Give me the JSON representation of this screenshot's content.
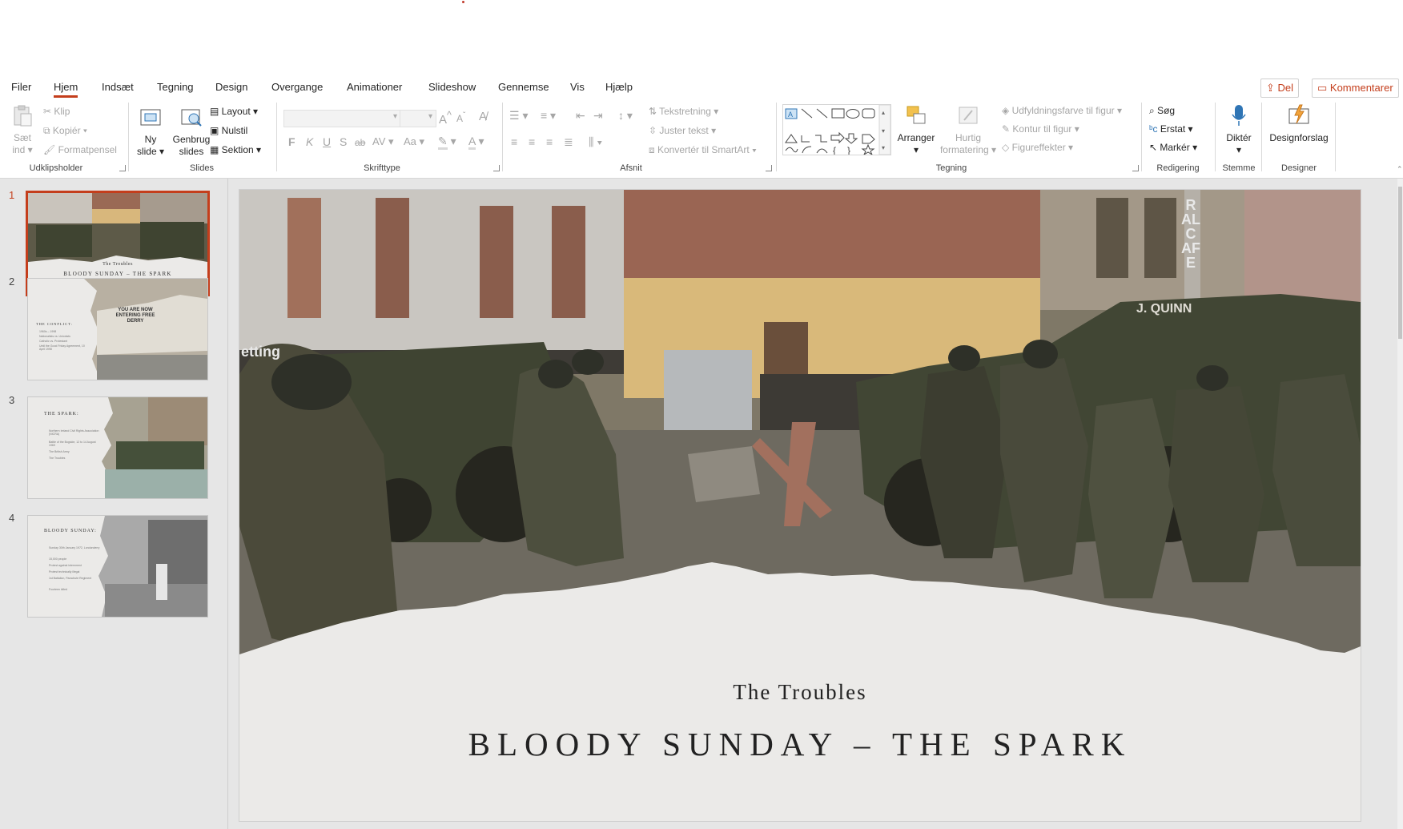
{
  "tabs": [
    "Filer",
    "Hjem",
    "Indsæt",
    "Tegning",
    "Design",
    "Overgange",
    "Animationer",
    "Slideshow",
    "Gennemse",
    "Vis",
    "Hjælp"
  ],
  "active_tab": "Hjem",
  "share": {
    "del": "Del",
    "comments": "Kommentarer"
  },
  "clipboard": {
    "paste_line1": "Sæt",
    "paste_line2": "ind",
    "cut": "Klip",
    "copy": "Kopiér",
    "format_painter": "Formatpensel",
    "label": "Udklipsholder"
  },
  "slides_group": {
    "new_line1": "Ny",
    "new_line2": "slide",
    "reuse_line1": "Genbrug",
    "reuse_line2": "slides",
    "layout": "Layout",
    "reset": "Nulstil",
    "section": "Sektion",
    "label": "Slides"
  },
  "font_group": {
    "bold": "F",
    "italic": "K",
    "underline": "U",
    "shadow": "S",
    "strike": "ab",
    "spacing": "AV",
    "case": "Aa",
    "grow": "A",
    "shrink": "A",
    "label": "Skrifttype"
  },
  "paragraph_group": {
    "text_direction": "Tekstretning",
    "align_text": "Juster tekst",
    "smartart": "Konvertér til SmartArt",
    "label": "Afsnit"
  },
  "drawing_group": {
    "arrange": "Arranger",
    "quick_line1": "Hurtig",
    "quick_line2": "formatering",
    "fill": "Udfyldningsfarve til figur",
    "outline": "Kontur til figur",
    "effects": "Figureffekter",
    "label": "Tegning"
  },
  "editing_group": {
    "find": "Søg",
    "replace": "Erstat",
    "select": "Markér",
    "label": "Redigering"
  },
  "voice_group": {
    "dictate": "Diktér",
    "label": "Stemme"
  },
  "designer_group": {
    "ideas": "Designforslag",
    "label": "Designer"
  },
  "thumbnails": [
    {
      "num": "1",
      "title": "The Troubles",
      "subtitle": "BLOODY SUNDAY – THE SPARK"
    },
    {
      "num": "2",
      "title": "THE CONFLICT:",
      "bullets": [
        "1960s – 1998",
        "Nationalists vs. Unionists",
        "Catholic vs. Protestant",
        "Until the Good Friday Agreement, 10 April 1998"
      ],
      "mural": "YOU ARE NOW ENTERING FREE DERRY"
    },
    {
      "num": "3",
      "title": "THE SPARK:",
      "bullets": [
        "Northern Ireland Civil Rights Association (NICRA)",
        "Battle of the Bogside, 12 to 14 August 1969",
        "The British Army",
        "The Troubles"
      ]
    },
    {
      "num": "4",
      "title": "BLOODY SUNDAY:",
      "bullets": [
        "Sunday 30th January 1972, Londonderry",
        "15,000 people",
        "Protest against internment",
        "Protest technically illegal",
        "1st Battalion, Parachute Regiment",
        "Fourteen killed"
      ]
    }
  ],
  "slide": {
    "subtitle": "The Troubles",
    "title": "BLOODY SUNDAY – THE SPARK",
    "photo_signs": {
      "ral_cafe": "RAL CAFE",
      "quinn": "J. QUINN",
      "etting": "etting"
    }
  },
  "colors": {
    "accent": "#c43e1c",
    "pane": "#e6e6e6",
    "slide_bg": "#ebeae8"
  }
}
